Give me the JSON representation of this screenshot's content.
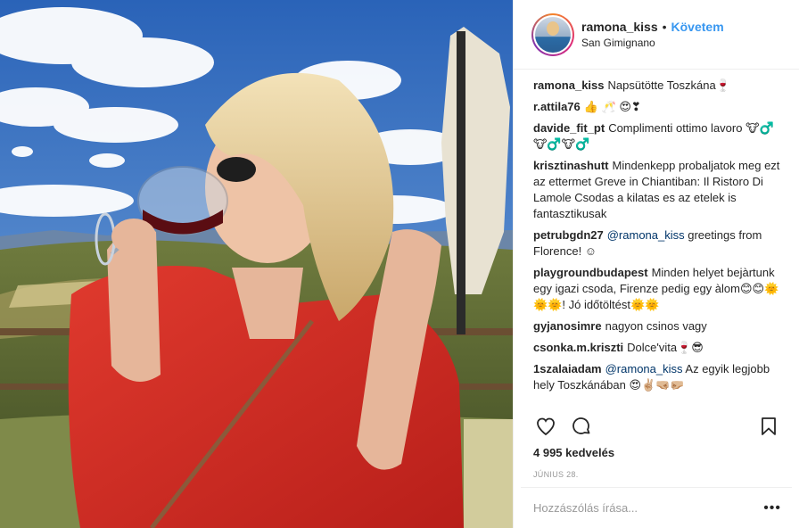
{
  "post": {
    "image_alt": "",
    "author": {
      "username": "ramona_kiss",
      "follow_label": "Követem",
      "location": "San Gimignano"
    },
    "comments": [
      {
        "user": "ramona_kiss",
        "text": "Napsütötte Toszkána🍷"
      },
      {
        "user": "r.attila76",
        "text": "👍 🥂 😍❣"
      },
      {
        "user": "davide_fit_pt",
        "text": "Complimenti ottimo lavoro 🐮♂️🐮♂️🐮♂️"
      },
      {
        "user": "krisztinashutt",
        "text": "Mindenkepp probaljatok meg ezt az ettermet Greve in Chiantiban: Il Ristoro Di Lamole Csodas a kilatas es az etelek is fantasztikusak"
      },
      {
        "user": "petrubgdn27",
        "mention": "@ramona_kiss",
        "text": " greetings from Florence! ☺"
      },
      {
        "user": "playgroundbudapest",
        "text": "Minden helyet bejàrtunk egy igazi csoda, Firenze pedig egy àlom😊😊🌞🌞🌞! Jó időtöltést🌞🌞"
      },
      {
        "user": "gyjanosimre",
        "text": "nagyon csinos vagy"
      },
      {
        "user": "csonka.m.kriszti",
        "text": "Dolce'vita🍷😎"
      },
      {
        "user": "1szalaiadam",
        "mention": "@ramona_kiss",
        "text": " Az egyik legjobb hely Toszkánában 😍✌🏼🤜🏼🤛🏼"
      }
    ],
    "likes": "4 995 kedvelés",
    "date": "JÚNIUS 28.",
    "comment_placeholder": "Hozzászólás írása...",
    "more_label": "•••"
  },
  "icons": {
    "like": "heart-icon",
    "comment": "comment-bubble-icon",
    "save": "bookmark-icon",
    "more": "more-options-icon"
  },
  "colors": {
    "link": "#3897f0",
    "text": "#262626",
    "muted": "#999999",
    "border": "#efefef"
  }
}
